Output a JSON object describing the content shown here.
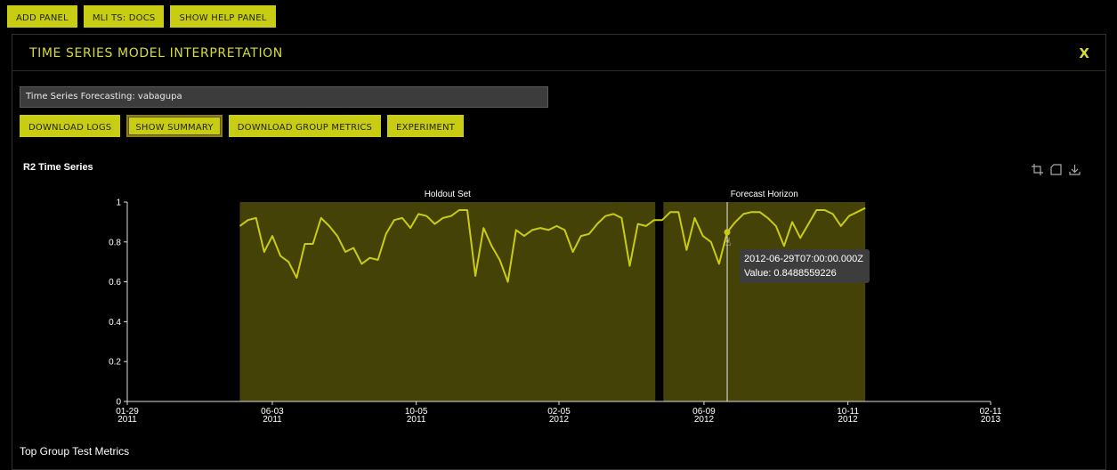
{
  "toolbar": {
    "add_panel": "ADD PANEL",
    "docs": "MLI TS: DOCS",
    "help": "SHOW HELP PANEL"
  },
  "panel": {
    "title": "TIME SERIES MODEL INTERPRETATION",
    "close": "X",
    "experiment_field": "Time Series Forecasting: vabagupa",
    "buttons": {
      "download_logs": "DOWNLOAD LOGS",
      "show_summary": "SHOW SUMMARY",
      "download_group_metrics": "DOWNLOAD GROUP METRICS",
      "experiment": "EXPERIMENT"
    },
    "chart_title": "R2 Time Series",
    "chart_tools": [
      "crop-icon",
      "restore-icon",
      "download-icon"
    ],
    "section_title": "Top Group Test Metrics"
  },
  "tooltip": {
    "date": "2012-06-29T07:00:00.000Z",
    "value": "Value: 0.8488559226"
  },
  "colors": {
    "accent": "#c8cd13",
    "band": "#454207",
    "line": "#c8cd13",
    "panel_title": "#d7db3a"
  },
  "chart_data": {
    "type": "line",
    "title": "R2 Time Series",
    "xlim": [
      "2011-01-29",
      "2013-02-11"
    ],
    "ylim": [
      0,
      1
    ],
    "y_ticks": [
      "0",
      "0.2",
      "0.4",
      "0.6",
      "0.8",
      "1"
    ],
    "x_ticks": [
      {
        "date": "2011-01-29",
        "line1": "01-29",
        "line2": "2011"
      },
      {
        "date": "2011-06-03",
        "line1": "06-03",
        "line2": "2011"
      },
      {
        "date": "2011-10-05",
        "line1": "10-05",
        "line2": "2011"
      },
      {
        "date": "2012-02-05",
        "line1": "02-05",
        "line2": "2012"
      },
      {
        "date": "2012-06-09",
        "line1": "06-09",
        "line2": "2012"
      },
      {
        "date": "2012-10-11",
        "line1": "10-11",
        "line2": "2012"
      },
      {
        "date": "2013-02-11",
        "line1": "02-11",
        "line2": "2013"
      }
    ],
    "bands": [
      {
        "label": "Holdout Set",
        "start": "2011-05-06",
        "end": "2012-04-28"
      },
      {
        "label": "Forecast Horizon",
        "start": "2012-05-05",
        "end": "2012-10-26"
      }
    ],
    "grid": false,
    "series": [
      {
        "points": [
          [
            "2011-05-06",
            0.88
          ],
          [
            "2011-05-13",
            0.91
          ],
          [
            "2011-05-20",
            0.92
          ],
          [
            "2011-05-27",
            0.75
          ],
          [
            "2011-06-03",
            0.83
          ],
          [
            "2011-06-10",
            0.73
          ],
          [
            "2011-06-17",
            0.7
          ],
          [
            "2011-06-24",
            0.62
          ],
          [
            "2011-07-01",
            0.79
          ],
          [
            "2011-07-08",
            0.79
          ],
          [
            "2011-07-15",
            0.92
          ],
          [
            "2011-07-22",
            0.88
          ],
          [
            "2011-07-29",
            0.83
          ],
          [
            "2011-08-05",
            0.75
          ],
          [
            "2011-08-12",
            0.77
          ],
          [
            "2011-08-19",
            0.69
          ],
          [
            "2011-08-26",
            0.72
          ],
          [
            "2011-09-02",
            0.71
          ],
          [
            "2011-09-09",
            0.84
          ],
          [
            "2011-09-16",
            0.91
          ],
          [
            "2011-09-23",
            0.92
          ],
          [
            "2011-09-30",
            0.87
          ],
          [
            "2011-10-07",
            0.94
          ],
          [
            "2011-10-14",
            0.93
          ],
          [
            "2011-10-21",
            0.89
          ],
          [
            "2011-10-28",
            0.92
          ],
          [
            "2011-11-04",
            0.93
          ],
          [
            "2011-11-11",
            0.96
          ],
          [
            "2011-11-18",
            0.96
          ],
          [
            "2011-11-25",
            0.63
          ],
          [
            "2011-12-02",
            0.87
          ],
          [
            "2011-12-09",
            0.78
          ],
          [
            "2011-12-16",
            0.71
          ],
          [
            "2011-12-23",
            0.6
          ],
          [
            "2011-12-30",
            0.86
          ],
          [
            "2012-01-06",
            0.83
          ],
          [
            "2012-01-13",
            0.86
          ],
          [
            "2012-01-20",
            0.87
          ],
          [
            "2012-01-27",
            0.86
          ],
          [
            "2012-02-03",
            0.88
          ],
          [
            "2012-02-10",
            0.86
          ],
          [
            "2012-02-17",
            0.75
          ],
          [
            "2012-02-24",
            0.83
          ],
          [
            "2012-03-02",
            0.84
          ],
          [
            "2012-03-09",
            0.89
          ],
          [
            "2012-03-16",
            0.93
          ],
          [
            "2012-03-23",
            0.94
          ],
          [
            "2012-03-30",
            0.92
          ],
          [
            "2012-04-06",
            0.68
          ],
          [
            "2012-04-13",
            0.89
          ],
          [
            "2012-04-20",
            0.88
          ],
          [
            "2012-04-27",
            0.91
          ],
          [
            "2012-05-04",
            0.91
          ],
          [
            "2012-05-11",
            0.95
          ],
          [
            "2012-05-18",
            0.95
          ],
          [
            "2012-05-25",
            0.76
          ],
          [
            "2012-06-01",
            0.92
          ],
          [
            "2012-06-08",
            0.83
          ],
          [
            "2012-06-15",
            0.8
          ],
          [
            "2012-06-22",
            0.69
          ],
          [
            "2012-06-29",
            0.849
          ],
          [
            "2012-07-06",
            0.9
          ],
          [
            "2012-07-13",
            0.94
          ],
          [
            "2012-07-20",
            0.95
          ],
          [
            "2012-07-27",
            0.95
          ],
          [
            "2012-08-03",
            0.92
          ],
          [
            "2012-08-10",
            0.88
          ],
          [
            "2012-08-17",
            0.78
          ],
          [
            "2012-08-24",
            0.9
          ],
          [
            "2012-08-31",
            0.82
          ],
          [
            "2012-09-07",
            0.89
          ],
          [
            "2012-09-14",
            0.96
          ],
          [
            "2012-09-21",
            0.96
          ],
          [
            "2012-09-28",
            0.94
          ],
          [
            "2012-10-05",
            0.88
          ],
          [
            "2012-10-12",
            0.93
          ],
          [
            "2012-10-19",
            0.95
          ],
          [
            "2012-10-26",
            0.97
          ]
        ]
      }
    ],
    "hover": {
      "date": "2012-06-29",
      "value": 0.8488559226
    }
  }
}
